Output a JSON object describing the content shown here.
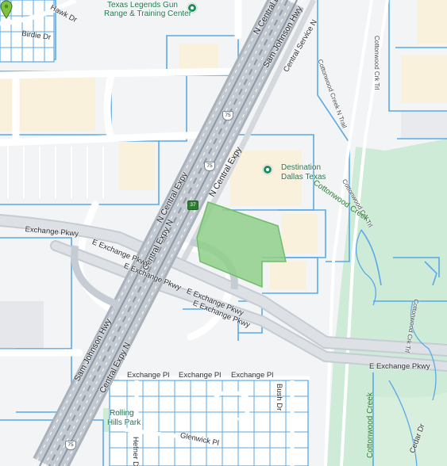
{
  "map": {
    "colors": {
      "background": "#f3f4f6",
      "parcel_outline": "#5aa9e6",
      "building": "#faf1dc",
      "highway": "#b9c0c9",
      "road": "#ffffff",
      "park": "#cdebd6",
      "selected_parcel": "#8fcf8a",
      "marker": "#7ec242",
      "poi": "#1e8e5a"
    },
    "selected_parcel_label": "",
    "marker_icon": "map-pin-icon"
  },
  "roads": {
    "central_expy_n_1": "N Central Expy",
    "central_expy_n_2": "N Central Expy",
    "central_expy_n_3": "N Central Expy",
    "central_expy_n_4": "Central Expy N",
    "central_expy_n_5": "Central Expy N",
    "sam_johnson_1": "Sam Johnson Hwy",
    "sam_johnson_2": "Sam Johnson Hwy",
    "central_service_n": "Central Service N",
    "exchange_pkwy_w": "Exchange Pkwy",
    "e_exchange_1": "E Exchange Pkwy",
    "e_exchange_2": "E Exchange Pkwy",
    "e_exchange_3": "E Exchange Pkwy",
    "e_exchange_4": "E Exchange Pkwy",
    "e_exchange_5": "E Exchange Pkwy",
    "exchange_pl_1": "Exchange Pl",
    "exchange_pl_2": "Exchange Pl",
    "exchange_pl_3": "Exchange Pl",
    "hawk_dr": "Hawk Dr",
    "birdie_dr": "Birdie Dr",
    "bush_dr": "Bush Dr",
    "hefner_dr": "Hefner Dr",
    "glenwick_pl": "Glenwick Pl",
    "cedar_dr": "Cedar Dr",
    "cottonwood_creek_n_trail": "Cottonwood Creek N Trail",
    "cottonwood_crk_trl_1": "Cottonwood Crk Trl",
    "cottonwood_crk_trl_2": "Cottonwood Crk Trl",
    "cottonwood_crk_trl_3": "Cottonwood Crk Trl"
  },
  "water": {
    "cottonwood_creek_1": "Cottonwood Creek",
    "cottonwood_creek_2": "Cottonwood Creek"
  },
  "pois": {
    "texas_legends_line1": "Texas Legends Gun",
    "texas_legends_line2": "Range & Training Center",
    "destination_line1": "Destination",
    "destination_line2": "Dallas Texas",
    "rolling_hills_line1": "Rolling",
    "rolling_hills_line2": "Hills Park"
  },
  "shields": {
    "us75_top": "75",
    "us75_mid": "75",
    "us75_bottom": "75",
    "exit_37": "37"
  }
}
